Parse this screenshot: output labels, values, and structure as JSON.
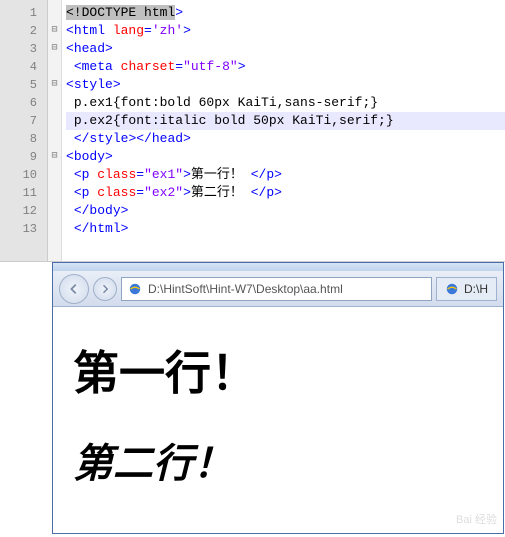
{
  "editor": {
    "line_numbers": [
      "1",
      "2",
      "3",
      "4",
      "5",
      "6",
      "7",
      "8",
      "9",
      "10",
      "11",
      "12",
      "13"
    ],
    "fold_markers": [
      "",
      "⊟",
      "⊟",
      "",
      "⊟",
      "",
      "",
      "",
      "⊟",
      "",
      "",
      "",
      ""
    ],
    "lines": {
      "l1": {
        "a": "<!",
        "b": "DOCTYPE html",
        "c": ">"
      },
      "l2": {
        "a": "<",
        "b": "html",
        "c": " lang",
        "d": "=",
        "e": "'zh'",
        "f": ">"
      },
      "l3": {
        "a": "<",
        "b": "head",
        "c": ">"
      },
      "l4": {
        "a": "<",
        "b": "meta",
        "c": " charset",
        "d": "=",
        "e": "\"utf-8\"",
        "f": ">"
      },
      "l5": {
        "a": "<",
        "b": "style",
        "c": ">"
      },
      "l6": "p.ex1{font:bold 60px KaiTi,sans-serif;}",
      "l7": "p.ex2{font:italic bold 50px KaiTi,serif;}",
      "l8": {
        "a": "</",
        "b": "style",
        "c": "></",
        "d": "head",
        "e": ">"
      },
      "l9": {
        "a": "<",
        "b": "body",
        "c": ">"
      },
      "l10": {
        "a": "<",
        "b": "p",
        "c": " class",
        "d": "=",
        "e": "\"ex1\"",
        "f": ">",
        "g": "第一行！",
        "h": " </",
        "i": "p",
        "j": ">"
      },
      "l11": {
        "a": "<",
        "b": "p",
        "c": " class",
        "d": "=",
        "e": "\"ex2\"",
        "f": ">",
        "g": "第二行！",
        "h": " </",
        "i": "p",
        "j": ">"
      },
      "l12": {
        "a": "</",
        "b": "body",
        "c": ">"
      },
      "l13": {
        "a": "</",
        "b": "html",
        "c": ">"
      }
    }
  },
  "browser": {
    "address": "D:\\HintSoft\\Hint-W7\\Desktop\\aa.html",
    "tab_label": "D:\\H",
    "page": {
      "line1": "第一行！",
      "line2": "第二行！"
    }
  },
  "watermark": "Bai 经验"
}
